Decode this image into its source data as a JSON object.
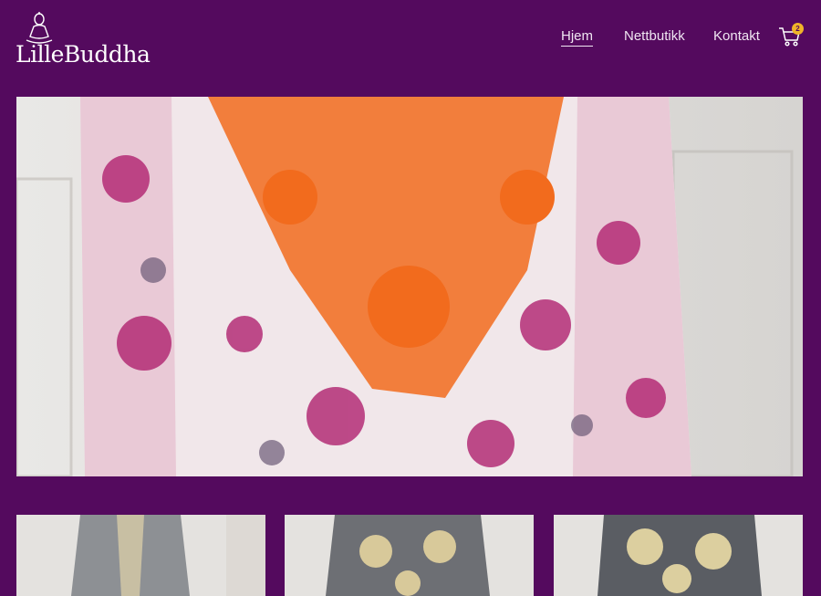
{
  "brand": {
    "name": "LilleBuddha"
  },
  "nav": {
    "home": "Hjem",
    "shop": "Nettbutikk",
    "contact": "Kontakt"
  },
  "cart": {
    "count": "2",
    "icon": "cart-icon"
  },
  "colors": {
    "background": "#540a5e",
    "badge": "#f0b429",
    "text": "#ffffff"
  }
}
